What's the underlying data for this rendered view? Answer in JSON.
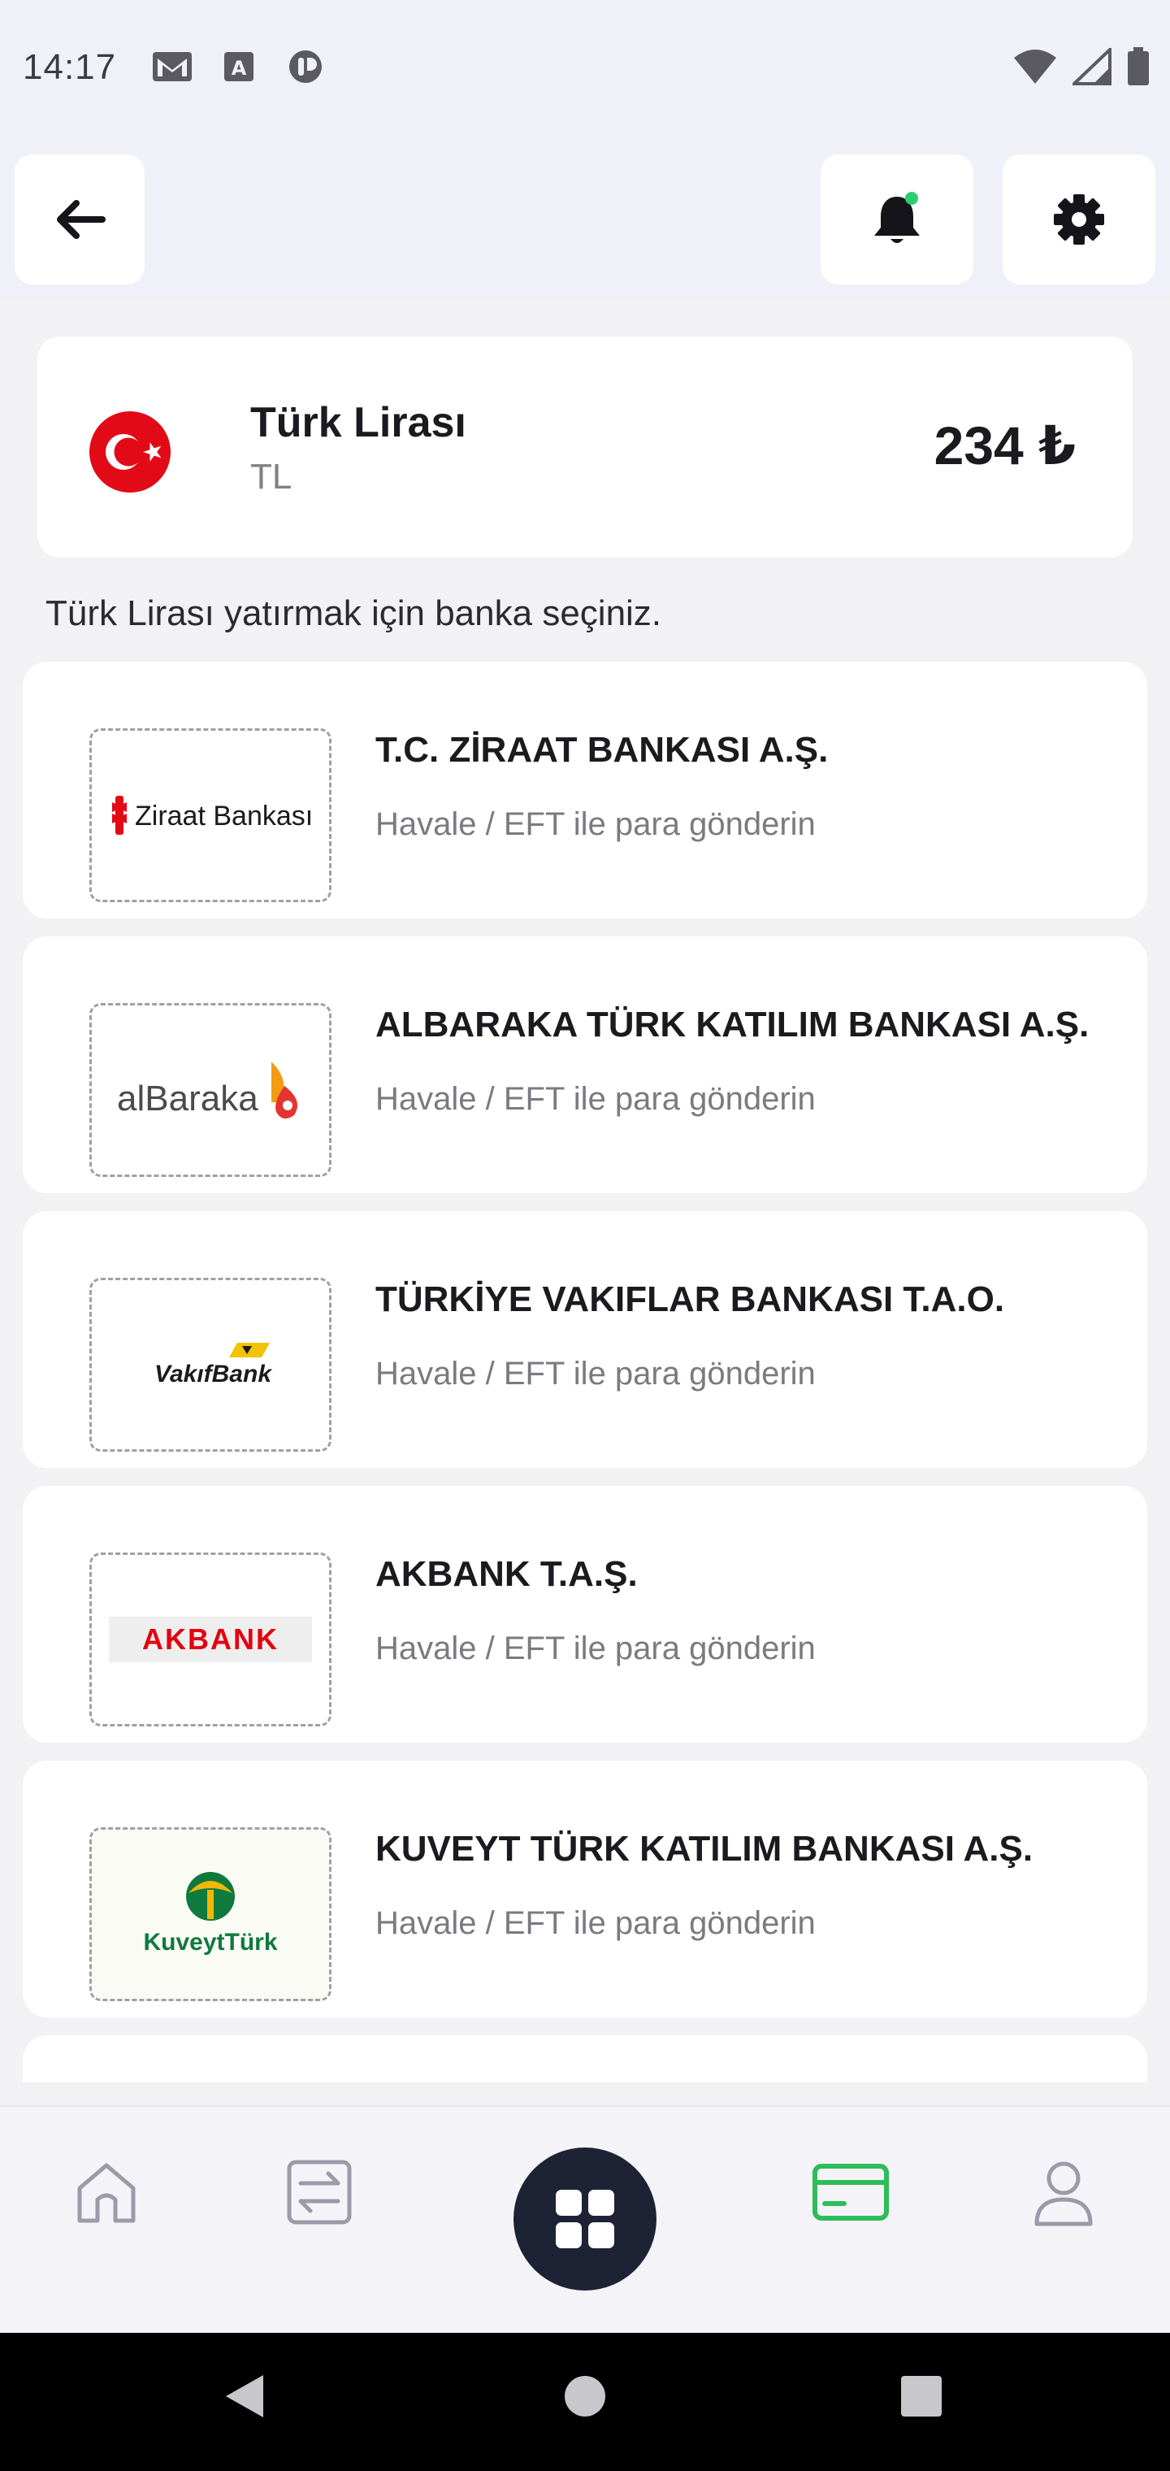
{
  "status_bar": {
    "time": "14:17",
    "left_icons": [
      "gmail-icon",
      "translate-icon",
      "app-notification-icon"
    ],
    "right_icons": [
      "wifi-icon",
      "cell-signal-icon",
      "battery-icon"
    ]
  },
  "top_bar": {
    "back_icon": "arrow-left-icon",
    "notification_icon": "bell-icon",
    "notification_dot_color": "#2ecc71",
    "settings_icon": "gear-icon"
  },
  "balance": {
    "currency_name": "Türk Lirası",
    "currency_code": "TL",
    "amount": "234 ₺",
    "flag_icon": "turkey-flag-icon"
  },
  "instruction": "Türk Lirası yatırmak için banka seçiniz.",
  "banks": [
    {
      "name": "T.C. ZİRAAT BANKASI A.Ş.",
      "subtitle": "Havale / EFT ile para gönderin",
      "logo_text": "Ziraat Bankası"
    },
    {
      "name": "ALBARAKA TÜRK KATILIM BANKASI A.Ş.",
      "subtitle": "Havale / EFT ile para gönderin",
      "logo_text": "alBaraka"
    },
    {
      "name": "TÜRKİYE VAKIFLAR BANKASI T.A.O.",
      "subtitle": "Havale / EFT ile para gönderin",
      "logo_text": "VakıfBank"
    },
    {
      "name": "AKBANK T.A.Ş.",
      "subtitle": "Havale / EFT ile para gönderin",
      "logo_text": "AKBANK"
    },
    {
      "name": "KUVEYT TÜRK KATILIM BANKASI A.Ş.",
      "subtitle": "Havale / EFT ile para gönderin",
      "logo_text": "KuveytTürk"
    }
  ],
  "bottom_nav": {
    "items": [
      "home-icon",
      "transfer-icon",
      "apps-grid-icon",
      "card-icon",
      "profile-icon"
    ],
    "active": "card-icon",
    "active_color": "#2ebd59",
    "inactive_color": "#9a9aa8",
    "center_color": "#1e2235"
  },
  "system_nav": [
    "back-triangle-icon",
    "home-circle-icon",
    "recents-square-icon"
  ]
}
